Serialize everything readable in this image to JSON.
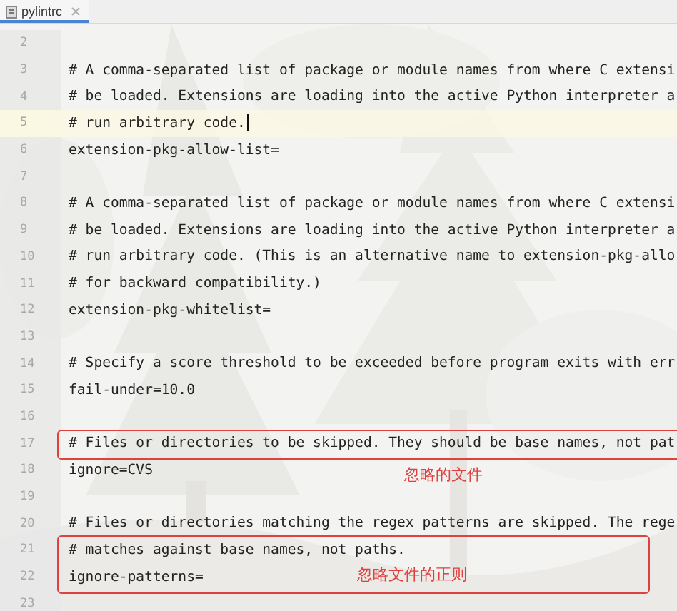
{
  "tabs": [
    {
      "label": "pylintrc",
      "selected": true,
      "closable": true
    }
  ],
  "lines": [
    {
      "number": "2",
      "current": false,
      "boxed": false
    },
    {
      "number": "3",
      "text": "# A comma-separated list of package or module names from where C extensi",
      "current": false,
      "boxed": false
    },
    {
      "number": "4",
      "text": "# be loaded. Extensions are loading into the active Python interpreter a",
      "current": false,
      "boxed": false
    },
    {
      "number": "5",
      "text": "# run arbitrary code.",
      "current": true,
      "boxed": false
    },
    {
      "number": "6",
      "text": "extension-pkg-allow-list=",
      "current": false,
      "boxed": false
    },
    {
      "number": "7",
      "current": false,
      "boxed": false
    },
    {
      "number": "8",
      "text": "# A comma-separated list of package or module names from where C extensi",
      "current": false,
      "boxed": false
    },
    {
      "number": "9",
      "text": "# be loaded. Extensions are loading into the active Python interpreter a",
      "current": false,
      "boxed": false
    },
    {
      "number": "10",
      "text": "# run arbitrary code. (This is an alternative name to extension-pkg-allo",
      "current": false,
      "boxed": false
    },
    {
      "number": "11",
      "text": "# for backward compatibility.)",
      "current": false,
      "boxed": false
    },
    {
      "number": "12",
      "text": "extension-pkg-whitelist=",
      "current": false,
      "boxed": false
    },
    {
      "number": "13",
      "current": false,
      "boxed": false
    },
    {
      "number": "14",
      "text": "# Specify a score threshold to be exceeded before program exits with err",
      "current": false,
      "boxed": false
    },
    {
      "number": "15",
      "text": "fail-under=10.0",
      "current": false,
      "boxed": false
    },
    {
      "number": "16",
      "current": false,
      "boxed": false
    },
    {
      "number": "17",
      "text": "# Files or directories to be skipped. They should be base names, not pat",
      "current": false,
      "boxed": true
    },
    {
      "number": "18",
      "text": "ignore=CVS",
      "current": false,
      "boxed": false
    },
    {
      "number": "19",
      "current": false,
      "boxed": false
    },
    {
      "number": "20",
      "text": "# Files or directories matching the regex patterns are skipped. The rege",
      "current": false,
      "boxed": false
    },
    {
      "number": "21",
      "text": "# matches against base names, not paths.",
      "current": false,
      "boxed": true
    },
    {
      "number": "22",
      "text": "ignore-patterns=",
      "current": false,
      "boxed": true
    },
    {
      "number": "23",
      "current": false,
      "boxed": false
    }
  ],
  "annotations": [
    {
      "label": "忽略的文件"
    },
    {
      "label": "忽略文件的正则"
    }
  ]
}
